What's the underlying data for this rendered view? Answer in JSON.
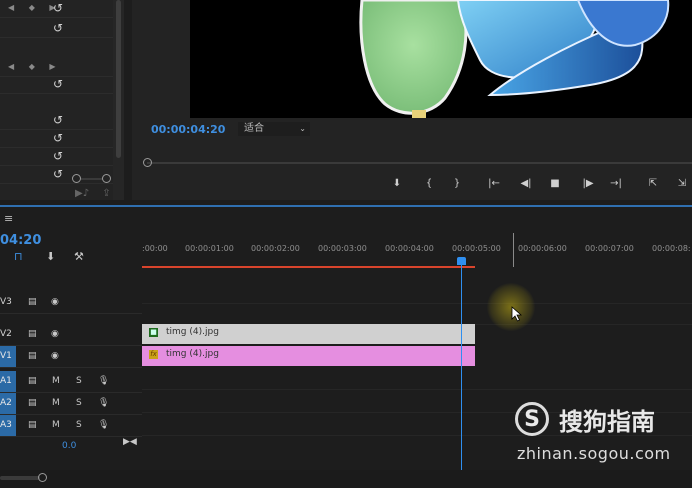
{
  "effects_panel": {
    "reset_rows": [
      "↺",
      "↺",
      "↺",
      "↺",
      "↺",
      "↺",
      "↺",
      "↺",
      "↺",
      "↺"
    ],
    "keyframe_nav": "◀ ◆ ▶"
  },
  "program_monitor": {
    "timecode": "00:00:04:20",
    "fit_label": "适合",
    "transport": [
      "⬇",
      "{",
      "}",
      "|←",
      "◀|",
      "■",
      "|▶",
      "→|",
      "⇱",
      "⇲"
    ]
  },
  "timeline": {
    "menu_icon": "≡",
    "timecode": "04:20",
    "ruler_ticks": [
      ":00:00",
      "00:00:01:00",
      "00:00:02:00",
      "00:00:03:00",
      "00:00:04:00",
      "00:00:05:00",
      "00:00:06:00",
      "00:00:07:00",
      "00:00:08:"
    ],
    "tracks": [
      {
        "name": "V3",
        "active": false,
        "type": "video"
      },
      {
        "name": "V2",
        "active": false,
        "type": "video"
      },
      {
        "name": "V1",
        "active": true,
        "type": "video"
      },
      {
        "name": "A1",
        "active": true,
        "type": "audio"
      },
      {
        "name": "A2",
        "active": true,
        "type": "audio"
      },
      {
        "name": "A3",
        "active": true,
        "type": "audio"
      }
    ],
    "clips": [
      {
        "track": "V2",
        "label": "timg (4).jpg",
        "color": "#d0d0d0"
      },
      {
        "track": "V1",
        "label": "timg (4).jpg",
        "color": "#e58ee0"
      }
    ],
    "master_volume": "0.0",
    "audio_m": "M",
    "audio_s": "S"
  },
  "watermark": {
    "logo_glyph": "S",
    "name": "搜狗指南",
    "url": "zhinan.sogou.com"
  }
}
